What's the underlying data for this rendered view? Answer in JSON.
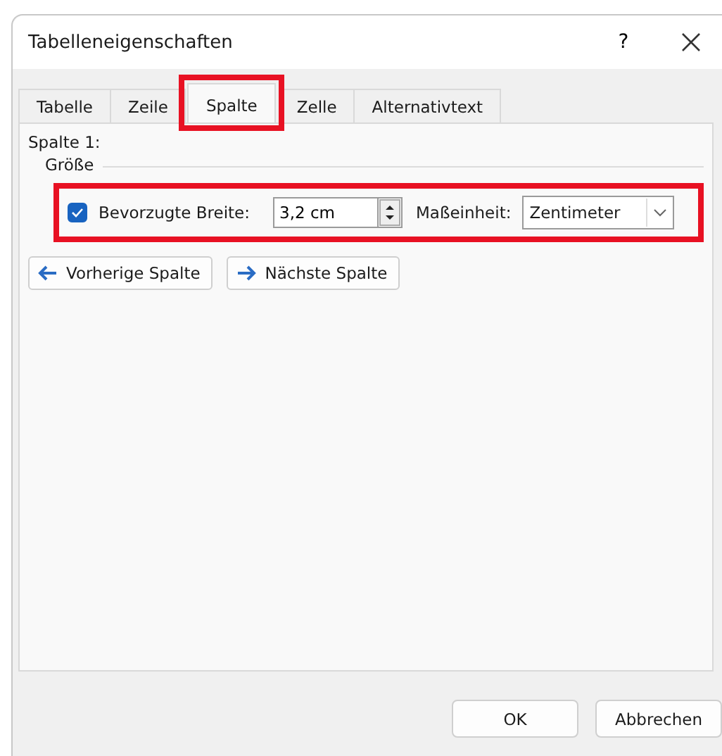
{
  "window": {
    "title": "Tabelleneigenschaften",
    "help": "?"
  },
  "tabs": [
    {
      "label": "Tabelle",
      "selected": false,
      "highlighted": false
    },
    {
      "label": "Zeile",
      "selected": false,
      "highlighted": false
    },
    {
      "label": "Spalte",
      "selected": true,
      "highlighted": true
    },
    {
      "label": "Zelle",
      "selected": false,
      "highlighted": false
    },
    {
      "label": "Alternativtext",
      "selected": false,
      "highlighted": false
    }
  ],
  "column_label": "Spalte 1:",
  "group": {
    "title": "Größe",
    "highlighted": true,
    "preferred_width": {
      "label": "Bevorzugte Breite:",
      "checked": true,
      "value": "3,2 cm"
    },
    "unit": {
      "label": "Maßeinheit:",
      "value": "Zentimeter"
    }
  },
  "nav_buttons": [
    {
      "label": "Vorherige Spalte",
      "kind": "previous"
    },
    {
      "label": "Nächste Spalte",
      "kind": "next"
    }
  ],
  "buttons": [
    "OK",
    "Abbrechen"
  ]
}
